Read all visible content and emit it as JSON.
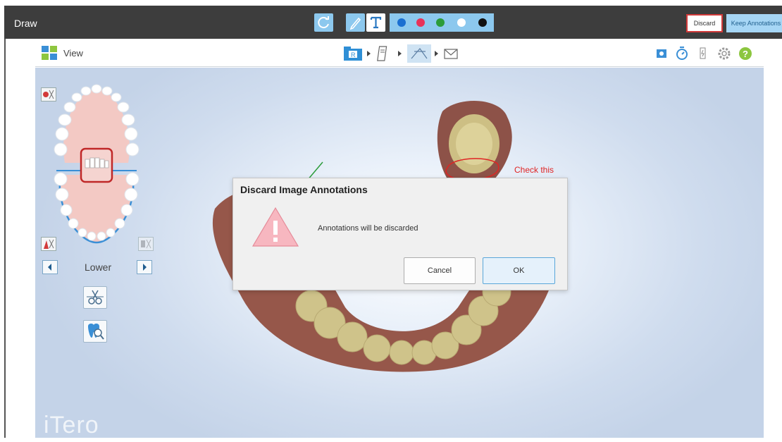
{
  "drawbar": {
    "title": "Draw",
    "discard_label": "Discard",
    "keep_label": "Keep Annotations",
    "colors": [
      "#1a6fd1",
      "#e8325a",
      "#2b9c3a",
      "#ffffff",
      "#111111"
    ]
  },
  "toolbar": {
    "view_label": "View"
  },
  "left_panel": {
    "arch_label": "Lower"
  },
  "annotation": {
    "text": "Check this"
  },
  "brand": {
    "logo": "iTero"
  },
  "dialog": {
    "title": "Discard Image Annotations",
    "message": "Annotations will be discarded",
    "cancel_label": "Cancel",
    "ok_label": "OK"
  },
  "accent": {
    "toolbar_blue": "#8cc8ee",
    "discard_border": "#d23a3a",
    "annotation_red": "#e02424"
  }
}
